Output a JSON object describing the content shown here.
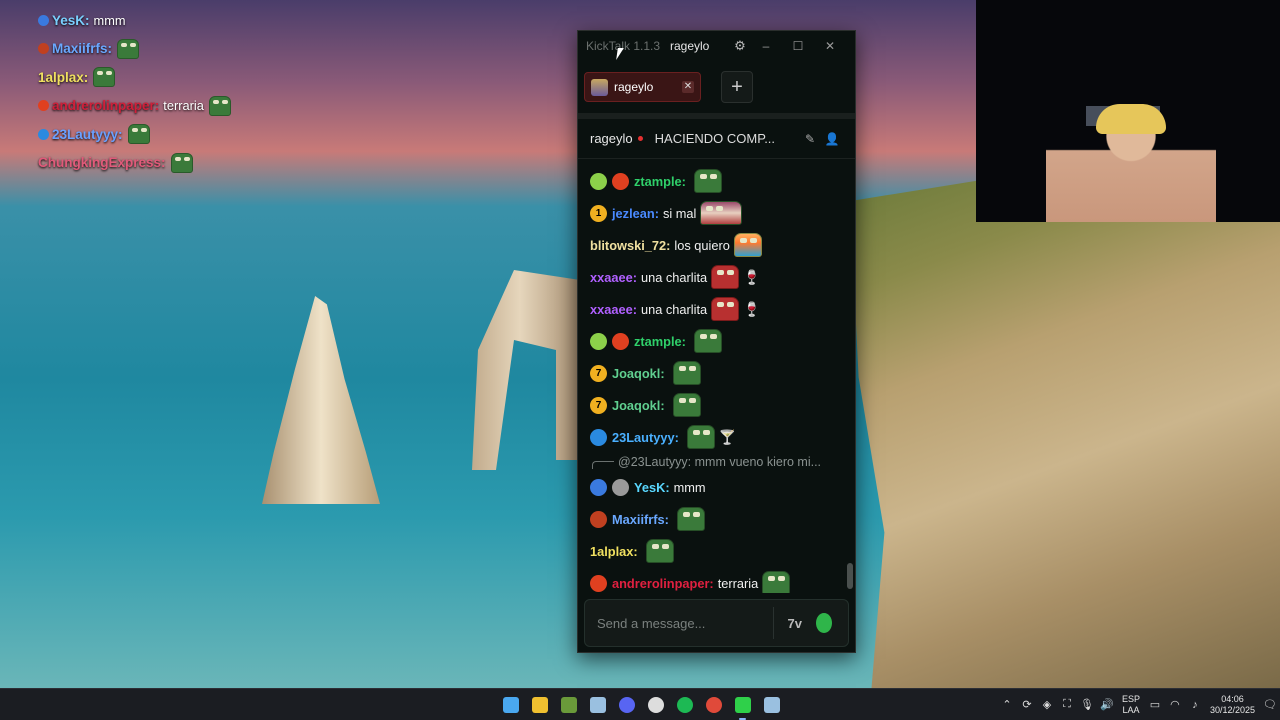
{
  "overlay": [
    {
      "name": "YesK",
      "text": "mmm",
      "color": "#7ad0ff",
      "badge": "#3a7adf",
      "emote": false
    },
    {
      "name": "Maxiifrfs",
      "text": "",
      "color": "#6aa8ff",
      "badge": "#c04020",
      "emote": true
    },
    {
      "name": "1alplax",
      "text": "",
      "color": "#f0e060",
      "badge": "",
      "emote": true
    },
    {
      "name": "andrerolinpaper",
      "text": "terraria",
      "color": "#d0203a",
      "badge": "#e04020",
      "emote": true
    },
    {
      "name": "23Lautyyy",
      "text": "",
      "color": "#6aa0ff",
      "badge": "#2a8ae0",
      "emote": true
    },
    {
      "name": "ChungkingExpress",
      "text": "",
      "color": "#e05a7a",
      "badge": "",
      "emote": true
    }
  ],
  "window": {
    "app_title": "KickTalk 1.1.3",
    "user": "rageylo",
    "minimize": "–",
    "maximize": "☐",
    "close": "✕"
  },
  "tab": {
    "label": "rageylo",
    "close": "✕",
    "add": "+"
  },
  "channel": {
    "name": "rageylo",
    "title": "HACIENDO COMP...",
    "pin_icon": "✎",
    "user_icon": "👤"
  },
  "messages": [
    {
      "name": "ztample",
      "sep": ":",
      "text": "",
      "color": "#2fd06a",
      "badges": [
        "#8cd04a",
        "#e04020"
      ],
      "emote": "pepe"
    },
    {
      "name": "jezlean",
      "sep": ":",
      "text": "si mal",
      "color": "#4a8aff",
      "badges": [
        "#f0b020"
      ],
      "badge_text": "1",
      "emote": "paint"
    },
    {
      "name": "blitowski_72",
      "sep": ":",
      "text": "los quiero",
      "color": "#f0e0a0",
      "badges": [],
      "emote": "pic"
    },
    {
      "name": "xxaaee",
      "sep": ":",
      "text": "una charlita",
      "color": "#b060ff",
      "badges": [],
      "emote": "heart"
    },
    {
      "name": "xxaaee",
      "sep": ":",
      "text": "una charlita",
      "color": "#b060ff",
      "badges": [],
      "emote": "heart"
    },
    {
      "name": "ztample",
      "sep": ":",
      "text": "",
      "color": "#2fd06a",
      "badges": [
        "#8cd04a",
        "#e04020"
      ],
      "emote": "pepe"
    },
    {
      "name": "Joaqokl",
      "sep": ":",
      "text": "",
      "color": "#60d090",
      "badges": [
        "#f0b020"
      ],
      "badge_text": "7",
      "emote": "pepe"
    },
    {
      "name": "Joaqokl",
      "sep": ":",
      "text": "",
      "color": "#60d090",
      "badges": [
        "#f0b020"
      ],
      "badge_text": "7",
      "emote": "pepe"
    },
    {
      "name": "23Lautyyy",
      "sep": ":",
      "text": "",
      "color": "#4ab0ff",
      "badges": [
        "#2a8ae0"
      ],
      "emote": "pepe"
    }
  ],
  "reply": {
    "text": "@23Lautyyy: mmm vueno kiero mi..."
  },
  "messages2": [
    {
      "name": "YesK",
      "sep": ":",
      "text": "mmm",
      "color": "#5ad8ff",
      "badges": [
        "#3a7adf",
        "#9a9a9a"
      ]
    },
    {
      "name": "Maxiifrfs",
      "sep": ":",
      "text": "",
      "color": "#6aa8ff",
      "badges": [
        "#c04020"
      ],
      "emote": "pepe"
    },
    {
      "name": "1alplax",
      "sep": ":",
      "text": "",
      "color": "#f0e060",
      "badges": [],
      "emote": "pepe"
    },
    {
      "name": "andrerolinpaper",
      "sep": ":",
      "text": "terraria",
      "color": "#e02040",
      "badges": [
        "#e04020"
      ],
      "emote": "pepe"
    }
  ],
  "input": {
    "placeholder": "Send a message..."
  },
  "tray": {
    "lang_top": "ESP",
    "lang_bottom": "LAA",
    "time": "04:06",
    "date": "30/12/2025"
  },
  "taskbar_apps": [
    {
      "name": "windows-start-icon",
      "color": "#4aa8f0"
    },
    {
      "name": "file-explorer-icon",
      "color": "#f0c030"
    },
    {
      "name": "minecraft-icon",
      "color": "#6a9a3a"
    },
    {
      "name": "steam-icon",
      "color": "#9ac0e0"
    },
    {
      "name": "discord-icon",
      "color": "#5865f2"
    },
    {
      "name": "obs-icon",
      "color": "#dddddd"
    },
    {
      "name": "spotify-icon",
      "color": "#1db954"
    },
    {
      "name": "chrome-icon",
      "color": "#e04a3a"
    },
    {
      "name": "kick-icon",
      "color": "#2fd04a"
    },
    {
      "name": "steam-icon-2",
      "color": "#9ac0e0"
    }
  ]
}
